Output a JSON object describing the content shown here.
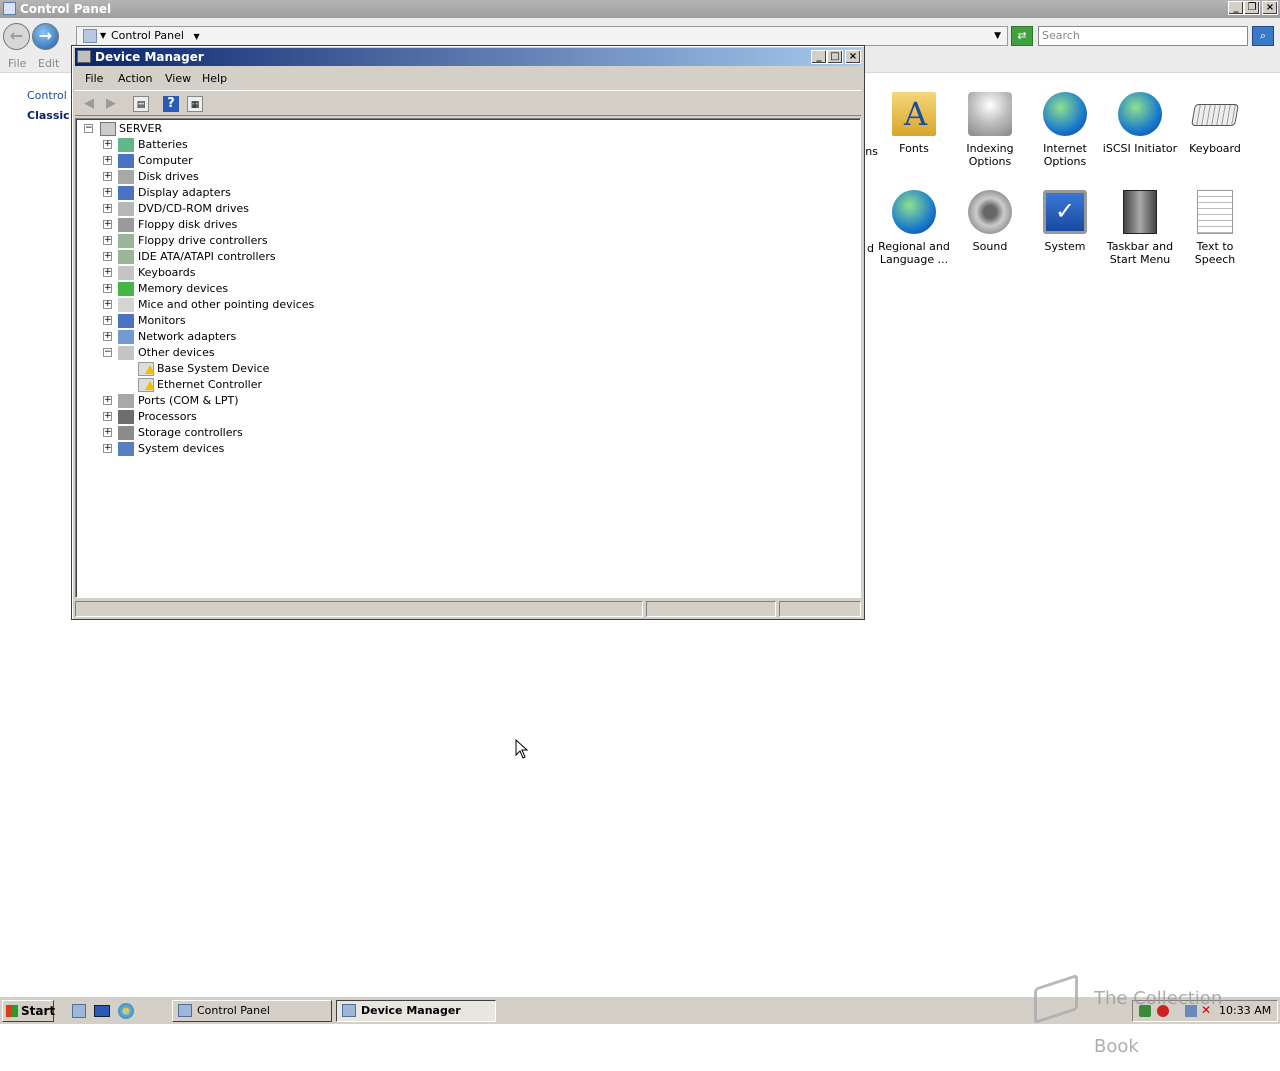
{
  "cp": {
    "title": "Control Panel",
    "breadcrumb": "Control Panel",
    "search_placeholder": "Search",
    "menu": [
      "File",
      "Edit"
    ],
    "left_link": "Control P",
    "left_view": "Classic V",
    "items_row1": [
      {
        "label": "ns"
      },
      {
        "label": "Fonts"
      },
      {
        "label": "Indexing Options"
      },
      {
        "label": "Internet Options"
      },
      {
        "label": "iSCSI Initiator"
      },
      {
        "label": "Keyboard"
      }
    ],
    "items_row2": [
      {
        "label": "d"
      },
      {
        "label": "Regional and Language ..."
      },
      {
        "label": "Sound"
      },
      {
        "label": "System"
      },
      {
        "label": "Taskbar and Start Menu"
      },
      {
        "label": "Text to Speech"
      }
    ]
  },
  "dm": {
    "title": "Device Manager",
    "menu": [
      "File",
      "Action",
      "View",
      "Help"
    ],
    "root": "SERVER",
    "nodes": [
      {
        "label": "Batteries",
        "icon": "battery-icon",
        "expanded": false
      },
      {
        "label": "Computer",
        "icon": "computer-icon",
        "expanded": false
      },
      {
        "label": "Disk drives",
        "icon": "disk-drive-icon",
        "expanded": false
      },
      {
        "label": "Display adapters",
        "icon": "display-adapter-icon",
        "expanded": false
      },
      {
        "label": "DVD/CD-ROM drives",
        "icon": "dvd-drive-icon",
        "expanded": false
      },
      {
        "label": "Floppy disk drives",
        "icon": "floppy-icon",
        "expanded": false
      },
      {
        "label": "Floppy drive controllers",
        "icon": "floppy-controller-icon",
        "expanded": false
      },
      {
        "label": "IDE ATA/ATAPI controllers",
        "icon": "ide-controller-icon",
        "expanded": false
      },
      {
        "label": "Keyboards",
        "icon": "keyboard-icon",
        "expanded": false
      },
      {
        "label": "Memory devices",
        "icon": "memory-icon",
        "expanded": false
      },
      {
        "label": "Mice and other pointing devices",
        "icon": "mouse-icon",
        "expanded": false
      },
      {
        "label": "Monitors",
        "icon": "monitor-icon",
        "expanded": false
      },
      {
        "label": "Network adapters",
        "icon": "network-adapter-icon",
        "expanded": false
      },
      {
        "label": "Other devices",
        "icon": "unknown-device-icon",
        "expanded": true,
        "children": [
          "Base System Device",
          "Ethernet Controller"
        ]
      },
      {
        "label": "Ports (COM & LPT)",
        "icon": "port-icon",
        "expanded": false
      },
      {
        "label": "Processors",
        "icon": "processor-icon",
        "expanded": false
      },
      {
        "label": "Storage controllers",
        "icon": "storage-controller-icon",
        "expanded": false
      },
      {
        "label": "System devices",
        "icon": "system-device-icon",
        "expanded": false
      }
    ]
  },
  "taskbar": {
    "start": "Start",
    "tasks": [
      "Control Panel",
      "Device Manager"
    ],
    "clock": "10:33 AM",
    "watermark": "The Collection Book"
  }
}
